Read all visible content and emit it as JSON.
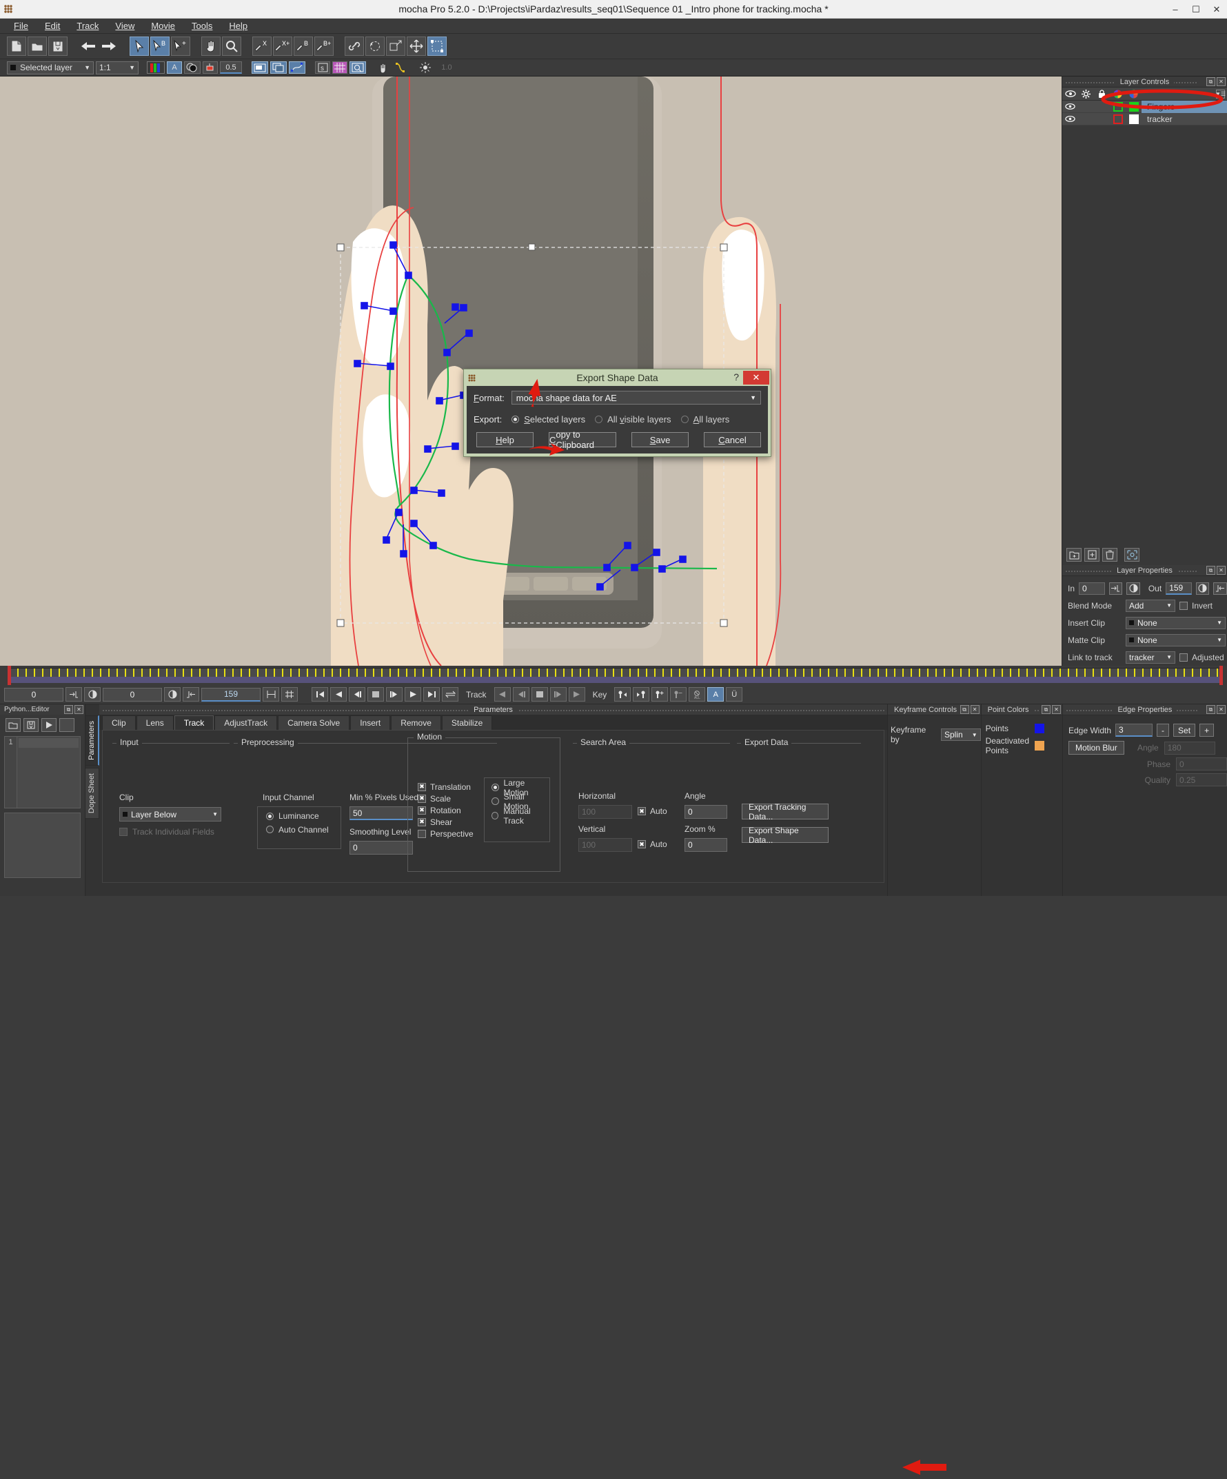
{
  "window": {
    "title": "mocha Pro 5.2.0 - D:\\Projects\\iPardaz\\results_seq01\\Sequence 01 _Intro phone for tracking.mocha *",
    "minimize": "–",
    "maximize": "☐",
    "close": "✕"
  },
  "menu": {
    "items": [
      "File",
      "Edit",
      "Track",
      "View",
      "Movie",
      "Tools",
      "Help"
    ]
  },
  "toolbar2": {
    "layer_select": "Selected layer",
    "zoom_level": "1:1",
    "opacity": "0.5",
    "gain": "1.0"
  },
  "layer_controls": {
    "title": "Layer Controls",
    "columns": [
      "eye-icon",
      "gear-icon",
      "lock-icon",
      "outline-color-icon",
      "fill-color-icon"
    ],
    "layers": [
      {
        "name": "Fingers",
        "selected": true,
        "visible": true,
        "outline_color": "#19d219",
        "fill_color": "#19d219"
      },
      {
        "name": "tracker",
        "selected": false,
        "visible": true,
        "outline_color": "#e02020",
        "fill_color": "#ffffff"
      }
    ]
  },
  "layer_properties": {
    "title": "Layer Properties",
    "in_label": "In",
    "in_value": "0",
    "out_label": "Out",
    "out_value": "159",
    "blend_mode_label": "Blend Mode",
    "blend_mode_value": "Add",
    "invert_label": "Invert",
    "insert_clip_label": "Insert Clip",
    "insert_clip_value": "None",
    "matte_clip_label": "Matte Clip",
    "matte_clip_value": "None",
    "link_to_track_label": "Link to track",
    "link_to_track_value": "tracker",
    "adjusted_label": "Adjusted"
  },
  "transport": {
    "current_frame": "0",
    "in_frame": "0",
    "out_frame": "159",
    "track_label": "Track",
    "key_label": "Key",
    "key_a": "A",
    "key_u": "Ü"
  },
  "python_editor": {
    "title": "Python...Editor",
    "line_number": "1"
  },
  "vtabs": {
    "parameters": "Parameters",
    "dope_sheet": "Dope Sheet"
  },
  "parameters": {
    "title": "Parameters",
    "tabs": [
      "Clip",
      "Lens",
      "Track",
      "AdjustTrack",
      "Camera Solve",
      "Insert",
      "Remove",
      "Stabilize"
    ],
    "active_tab": "Track",
    "input": {
      "group": "Input",
      "clip_label": "Clip",
      "clip_value": "Layer Below",
      "track_individual_fields": "Track Individual Fields"
    },
    "preprocessing": {
      "group": "Preprocessing",
      "input_channel_label": "Input Channel",
      "channel_options": [
        "Luminance",
        "Auto Channel"
      ],
      "channel_selected": "Luminance",
      "min_pixels_label": "Min % Pixels Used",
      "min_pixels_value": "50",
      "smoothing_label": "Smoothing Level",
      "smoothing_value": "0"
    },
    "motion": {
      "group": "Motion",
      "checks": [
        {
          "label": "Translation",
          "checked": true
        },
        {
          "label": "Scale",
          "checked": true
        },
        {
          "label": "Rotation",
          "checked": true
        },
        {
          "label": "Shear",
          "checked": true
        },
        {
          "label": "Perspective",
          "checked": false
        }
      ],
      "radios": [
        "Large Motion",
        "Small Motion",
        "Manual Track"
      ],
      "radio_selected": "Large Motion"
    },
    "search_area": {
      "group": "Search Area",
      "horizontal_label": "Horizontal",
      "horizontal_value": "100",
      "horizontal_auto": "Auto",
      "vertical_label": "Vertical",
      "vertical_value": "100",
      "vertical_auto": "Auto",
      "angle_label": "Angle",
      "angle_value": "0",
      "zoom_label": "Zoom %",
      "zoom_value": "0"
    },
    "export_data": {
      "group": "Export Data",
      "export_tracking": "Export Tracking Data...",
      "export_shape": "Export Shape Data..."
    }
  },
  "keyframe_controls": {
    "title": "Keyframe Controls",
    "keyframe_by_label": "Keyframe by",
    "keyframe_by_value": "Splin"
  },
  "point_colors": {
    "title": "Point Colors",
    "points_label": "Points",
    "points_color": "#1414e8",
    "deactivated_label": "Deactivated Points",
    "deactivated_color": "#f0a450"
  },
  "edge_properties": {
    "title": "Edge Properties",
    "edge_width_label": "Edge Width",
    "edge_width_value": "3",
    "minus": "-",
    "set": "Set",
    "plus": "+",
    "motion_blur": "Motion Blur",
    "angle_label": "Angle",
    "angle_value": "180",
    "phase_label": "Phase",
    "phase_value": "0",
    "quality_label": "Quality",
    "quality_value": "0.25"
  },
  "dialog": {
    "title": "Export Shape Data",
    "help_glyph": "?",
    "close_glyph": "✕",
    "format_label": "Format:",
    "format_value": "mocha shape data for AE",
    "export_label": "Export:",
    "export_options": [
      {
        "label": "Selected layers",
        "selected": true
      },
      {
        "label": "All visible layers",
        "selected": false
      },
      {
        "label": "All layers",
        "selected": false
      }
    ],
    "buttons": [
      "Help",
      "Copy to Clipboard",
      "Save",
      "Cancel"
    ]
  },
  "colors": {
    "accent_blue": "#5a8fc8",
    "selection_blue": "#6f93b5",
    "spline_green": "#19b84a",
    "point_blue": "#1414e8",
    "mask_red": "#e84040",
    "dialog_green": "#c6d4b4",
    "arrow_red": "#e01b10"
  }
}
